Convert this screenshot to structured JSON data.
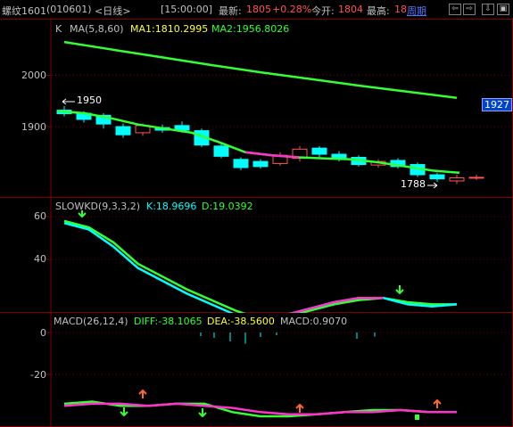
{
  "header": {
    "symbol": "螺纹1601",
    "code": "(010601)",
    "period": "<日线>",
    "time": "[15:00:00]",
    "last_label": "最新:",
    "last_value": "1805",
    "change_pct": "+0.28%",
    "open_label": "今开:",
    "open_value": "1804",
    "high_label": "最高:",
    "high_value": "18",
    "period_link": "周期",
    "buttons": [
      "⇦",
      "⇨",
      "⇩",
      "▣"
    ]
  },
  "main": {
    "k_label": "K",
    "ma_title": "MA(5,8,60)",
    "ma1_text": "MA1:1810.2995",
    "ma2_text": "MA2:1956.8026",
    "y_labels": [
      "2000",
      "1900"
    ],
    "high_marker": "1950",
    "low_marker": "1788",
    "price_tag": "1927"
  },
  "kd": {
    "title": "SLOWKD(9,3,3,2)",
    "k_text": "K:18.9696",
    "d_text": "D:19.0392",
    "y_labels": [
      "60",
      "40"
    ]
  },
  "macd": {
    "title": "MACD(26,12,4)",
    "diff_text": "DIFF:-38.1065",
    "dea_text": "DEA:-38.5600",
    "macd_text": "MACD:0.9070",
    "y_labels": [
      "0",
      "-20"
    ]
  },
  "colors": {
    "up": "#ff5555",
    "down": "#00ffff",
    "ma_green": "#33ff33",
    "ma_magenta": "#ff33cc",
    "axis_red": "#800000",
    "yellow": "#ffff33",
    "link_blue": "#5577ff"
  },
  "chart_data": {
    "type": "candlestick",
    "candles": [
      {
        "o": 1932,
        "c": 1925,
        "h": 1940,
        "l": 1920
      },
      {
        "o": 1926,
        "c": 1914,
        "h": 1930,
        "l": 1908
      },
      {
        "o": 1922,
        "c": 1905,
        "h": 1926,
        "l": 1896
      },
      {
        "o": 1900,
        "c": 1884,
        "h": 1906,
        "l": 1878
      },
      {
        "o": 1888,
        "c": 1902,
        "h": 1906,
        "l": 1882
      },
      {
        "o": 1898,
        "c": 1893,
        "h": 1904,
        "l": 1888
      },
      {
        "o": 1902,
        "c": 1893,
        "h": 1910,
        "l": 1888
      },
      {
        "o": 1892,
        "c": 1864,
        "h": 1896,
        "l": 1860
      },
      {
        "o": 1862,
        "c": 1842,
        "h": 1866,
        "l": 1838
      },
      {
        "o": 1836,
        "c": 1820,
        "h": 1840,
        "l": 1815
      },
      {
        "o": 1832,
        "c": 1822,
        "h": 1836,
        "l": 1818
      },
      {
        "o": 1828,
        "c": 1844,
        "h": 1850,
        "l": 1824
      },
      {
        "o": 1838,
        "c": 1856,
        "h": 1862,
        "l": 1832
      },
      {
        "o": 1858,
        "c": 1846,
        "h": 1862,
        "l": 1840
      },
      {
        "o": 1846,
        "c": 1838,
        "h": 1852,
        "l": 1832
      },
      {
        "o": 1840,
        "c": 1826,
        "h": 1844,
        "l": 1822
      },
      {
        "o": 1825,
        "c": 1832,
        "h": 1836,
        "l": 1820
      },
      {
        "o": 1834,
        "c": 1822,
        "h": 1838,
        "l": 1818
      },
      {
        "o": 1826,
        "c": 1806,
        "h": 1830,
        "l": 1802
      },
      {
        "o": 1806,
        "c": 1798,
        "h": 1810,
        "l": 1792
      },
      {
        "o": 1794,
        "c": 1800,
        "h": 1806,
        "l": 1788
      },
      {
        "o": 1800,
        "c": 1801,
        "h": 1806,
        "l": 1796
      }
    ],
    "ma_slow": [
      2065,
      2050,
      2035,
      2020,
      2006,
      1993,
      1980,
      1968,
      1956
    ],
    "ma_fast": [
      1930,
      1926,
      1916,
      1904,
      1896,
      1888,
      1870,
      1850,
      1844,
      1840,
      1838,
      1836,
      1830,
      1822,
      1814,
      1810
    ],
    "slowkd_k": [
      57,
      54,
      46,
      36,
      30,
      24,
      19,
      14,
      11,
      14,
      17,
      20,
      22,
      22,
      19,
      18,
      19
    ],
    "slowkd_d": [
      58,
      55,
      48,
      38,
      32,
      26,
      21,
      16,
      12,
      13,
      16,
      19,
      21,
      22,
      20,
      19,
      19
    ],
    "macd_diff": [
      -34,
      -33,
      -35,
      -35,
      -34,
      -34,
      -38,
      -40,
      -40,
      -39,
      -38,
      -37,
      -37,
      -38,
      -38
    ],
    "macd_dea": [
      -35,
      -34,
      -34,
      -35,
      -34,
      -35,
      -36,
      -38,
      -39,
      -39,
      -38,
      -38,
      -37,
      -38,
      -38
    ],
    "macd_bars": [
      0.8,
      1.2,
      -2.0,
      -2.5,
      1.0,
      0.6,
      1.4,
      0.9
    ]
  }
}
